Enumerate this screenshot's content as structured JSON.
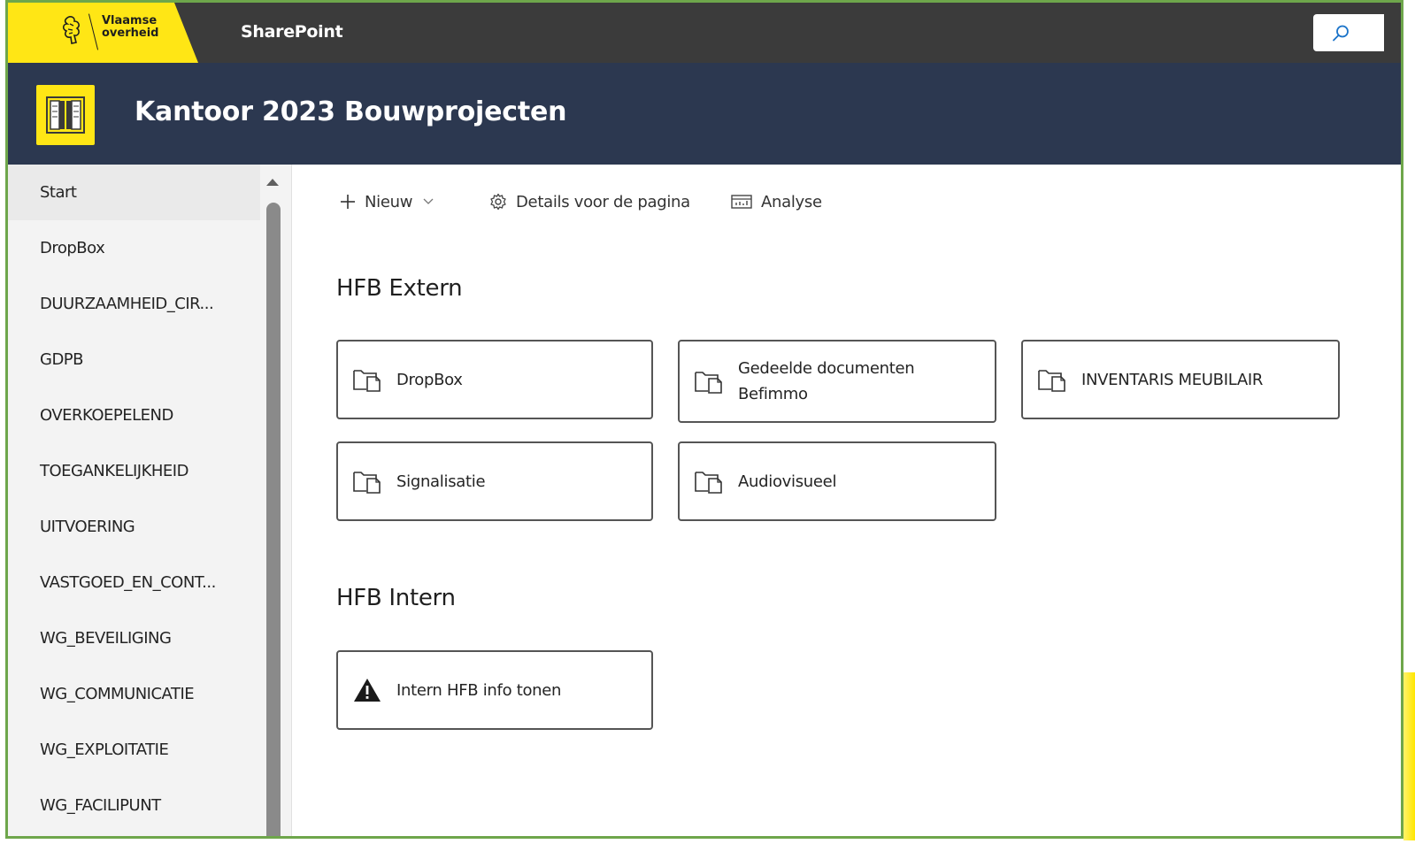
{
  "suitebar": {
    "brand_line1": "Vlaamse",
    "brand_line2": "overheid",
    "app_name": "SharePoint",
    "search_icon": "search-icon"
  },
  "site": {
    "title": "Kantoor 2023 Bouwprojecten",
    "logo_icon": "building-icon"
  },
  "nav": {
    "items": [
      {
        "label": "Start",
        "active": true
      },
      {
        "label": "DropBox"
      },
      {
        "label": "DUURZAAMHEID_CIR..."
      },
      {
        "label": "GDPB"
      },
      {
        "label": "OVERKOEPELEND"
      },
      {
        "label": "TOEGANKELIJKHEID"
      },
      {
        "label": "UITVOERING"
      },
      {
        "label": "VASTGOED_EN_CONT..."
      },
      {
        "label": "WG_BEVEILIGING"
      },
      {
        "label": "WG_COMMUNICATIE"
      },
      {
        "label": "WG_EXPLOITATIE"
      },
      {
        "label": "WG_FACILIPUNT"
      }
    ]
  },
  "commandbar": {
    "new_label": "Nieuw",
    "details_label": "Details voor de pagina",
    "analyse_label": "Analyse"
  },
  "sections": [
    {
      "title": "HFB Extern",
      "tiles": [
        {
          "line1": "DropBox",
          "line2": "",
          "icon": "folder-document-icon"
        },
        {
          "line1": "Gedeelde documenten",
          "line2": "Befimmo",
          "icon": "folder-document-icon"
        },
        {
          "line1": "INVENTARIS MEUBILAIR",
          "line2": "",
          "icon": "folder-document-icon"
        },
        {
          "line1": "Signalisatie",
          "line2": "",
          "icon": "folder-document-icon"
        },
        {
          "line1": "Audiovisueel",
          "line2": "",
          "icon": "folder-document-icon"
        }
      ]
    },
    {
      "title": "HFB Intern",
      "tiles": [
        {
          "line1": "Intern HFB info tonen",
          "line2": "",
          "icon": "warning-icon"
        }
      ]
    }
  ],
  "colors": {
    "brand_yellow": "#ffe615",
    "suitebar": "#3b3b3b",
    "site_header": "#2c3850",
    "frame_border": "#6ea64b"
  }
}
